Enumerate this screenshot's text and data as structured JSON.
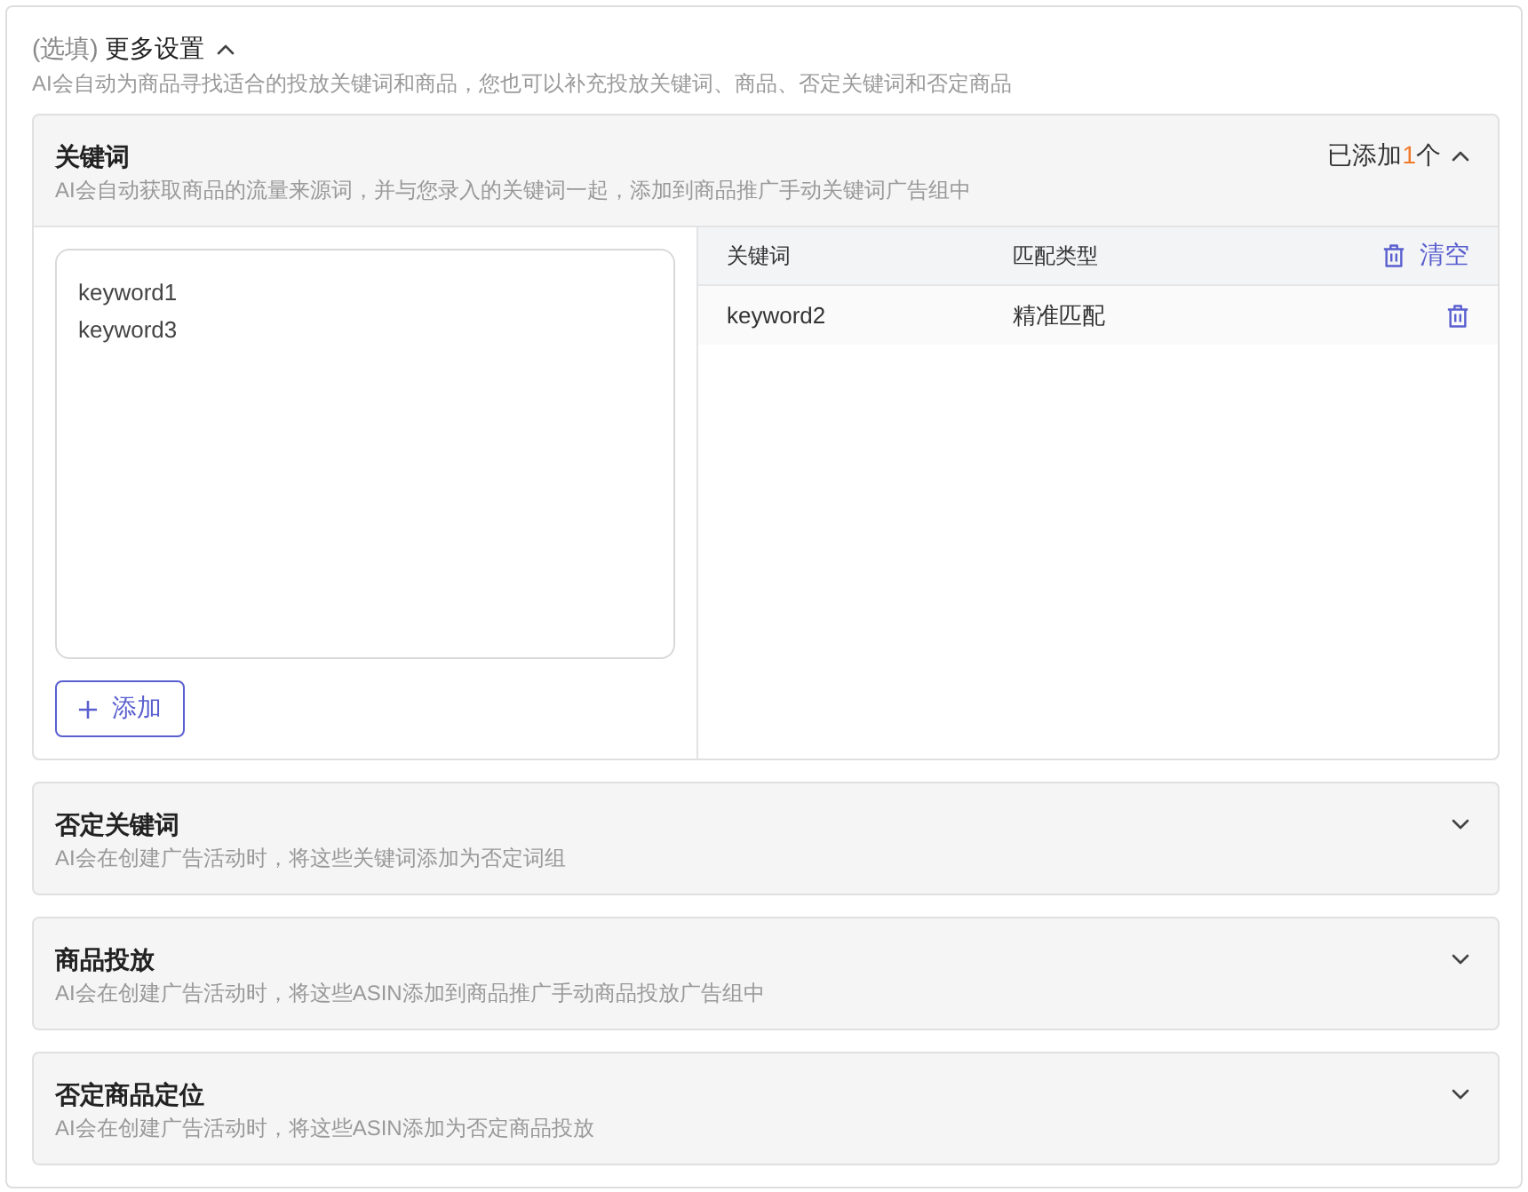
{
  "settings": {
    "optional_tag": "(选填)",
    "title": "更多设置",
    "expanded": true,
    "description": "AI会自动为商品寻找适合的投放关键词和商品，您也可以补充投放关键词、商品、否定关键词和否定商品"
  },
  "sections": [
    {
      "title": "关键词",
      "description": "AI会自动获取商品的流量来源词，并与您录入的关键词一起，添加到商品推广手动关键词广告组中",
      "expanded": true,
      "added_status": {
        "prefix": "已添加",
        "count": "1",
        "suffix": "个"
      },
      "keyword_input": {
        "lines": [
          "keyword1",
          "keyword3"
        ]
      },
      "add_button": "添加",
      "table": {
        "columns": [
          "关键词",
          "匹配类型"
        ],
        "clear_button": "清空",
        "rows": [
          {
            "keyword": "keyword2",
            "match_type": "精准匹配"
          }
        ]
      }
    },
    {
      "title": "否定关键词",
      "description": "AI会在创建广告活动时，将这些关键词添加为否定词组",
      "expanded": false
    },
    {
      "title": "商品投放",
      "description": "AI会在创建广告活动时，将这些ASIN添加到商品推广手动商品投放广告组中",
      "expanded": false
    },
    {
      "title": "否定商品定位",
      "description": "AI会在创建广告活动时，将这些ASIN添加为否定商品投放",
      "expanded": false
    }
  ]
}
